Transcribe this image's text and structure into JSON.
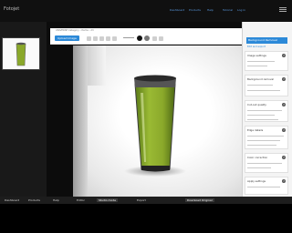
{
  "app": {
    "logo": "Fotojet"
  },
  "topnav": [
    "Dashboard",
    "Products",
    "Help",
    "Tutorial",
    "Log in"
  ],
  "toolbar": {
    "breadcrumb": "UNIVERSE Category › Items › 23",
    "upload_label": "Upload image"
  },
  "colors": {
    "accent": "#2c89d8",
    "liquid": "#8aa82a",
    "black_swatch": "#111111",
    "gray_swatch": "#777777"
  },
  "right_panel": {
    "header": "Background Removal",
    "subtitle": "Edit and export",
    "sections": [
      {
        "title": "Image settings"
      },
      {
        "title": "Background removal"
      },
      {
        "title": "Cut-out quality"
      },
      {
        "title": "Edge details"
      },
      {
        "title": "Color correction"
      },
      {
        "title": "Apply settings"
      }
    ]
  },
  "bottom_tabs": [
    {
      "label": "Dashboard"
    },
    {
      "label": "Products"
    },
    {
      "label": "Help"
    },
    {
      "label": "Editor"
    },
    {
      "label": "Studio mode",
      "active": true
    },
    {
      "label": "Export"
    },
    {
      "label": "Download Original",
      "active": true
    }
  ]
}
